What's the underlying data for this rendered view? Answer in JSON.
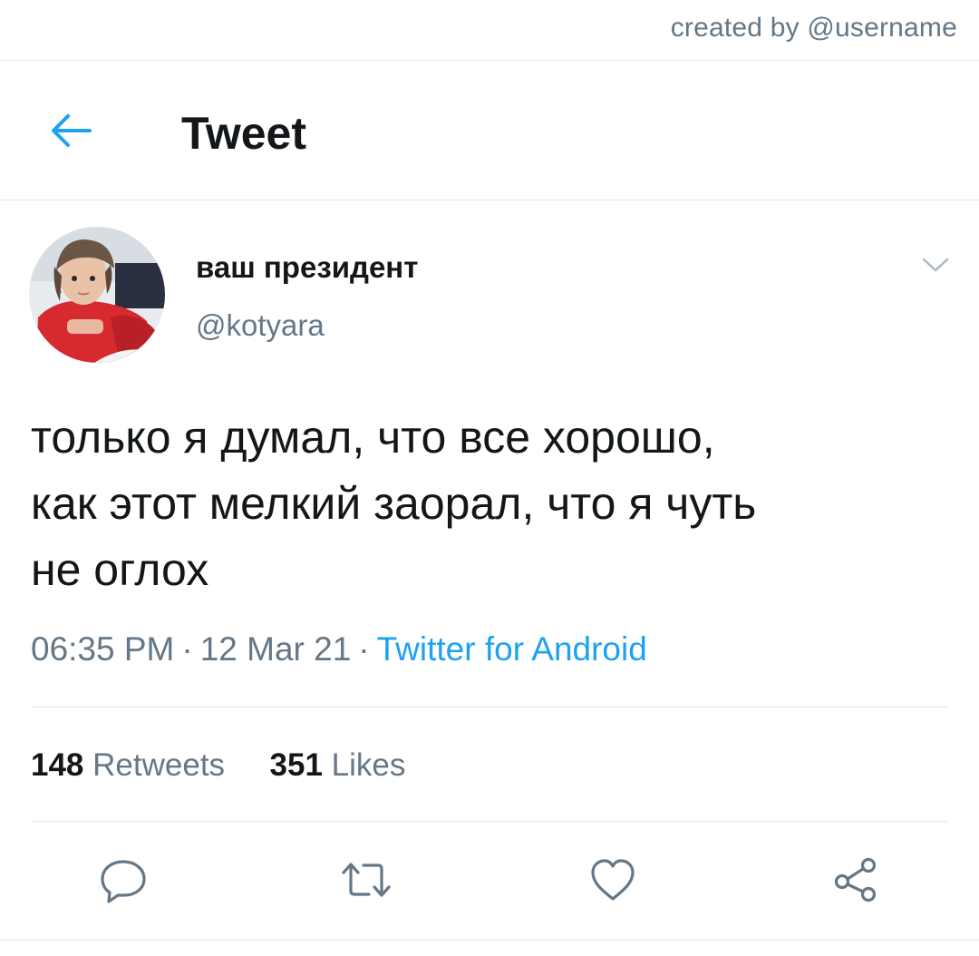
{
  "credit": "created by @username",
  "header": {
    "title": "Tweet",
    "back_icon": "arrow-left-icon",
    "accent_color": "#1da1f2"
  },
  "tweet": {
    "author": {
      "display_name": "ваш президент",
      "handle": "@kotyara"
    },
    "text_lines": [
      "только я думал, что все хорошо,",
      "как этот мелкий заорал, что я чуть",
      "не оглох"
    ],
    "time": "06:35 PM",
    "date": "12 Mar 21",
    "separator": "·",
    "source": "Twitter for Android",
    "retweets_count": "148",
    "retweets_label": "Retweets",
    "likes_count": "351",
    "likes_label": "Likes"
  },
  "actions": [
    {
      "name": "reply",
      "icon": "reply-icon"
    },
    {
      "name": "retweet",
      "icon": "retweet-icon"
    },
    {
      "name": "like",
      "icon": "heart-icon"
    },
    {
      "name": "share",
      "icon": "share-icon"
    }
  ],
  "colors": {
    "text_primary": "#14171a",
    "text_secondary": "#657786",
    "link": "#1da1f2",
    "divider": "#e1e8ed"
  }
}
